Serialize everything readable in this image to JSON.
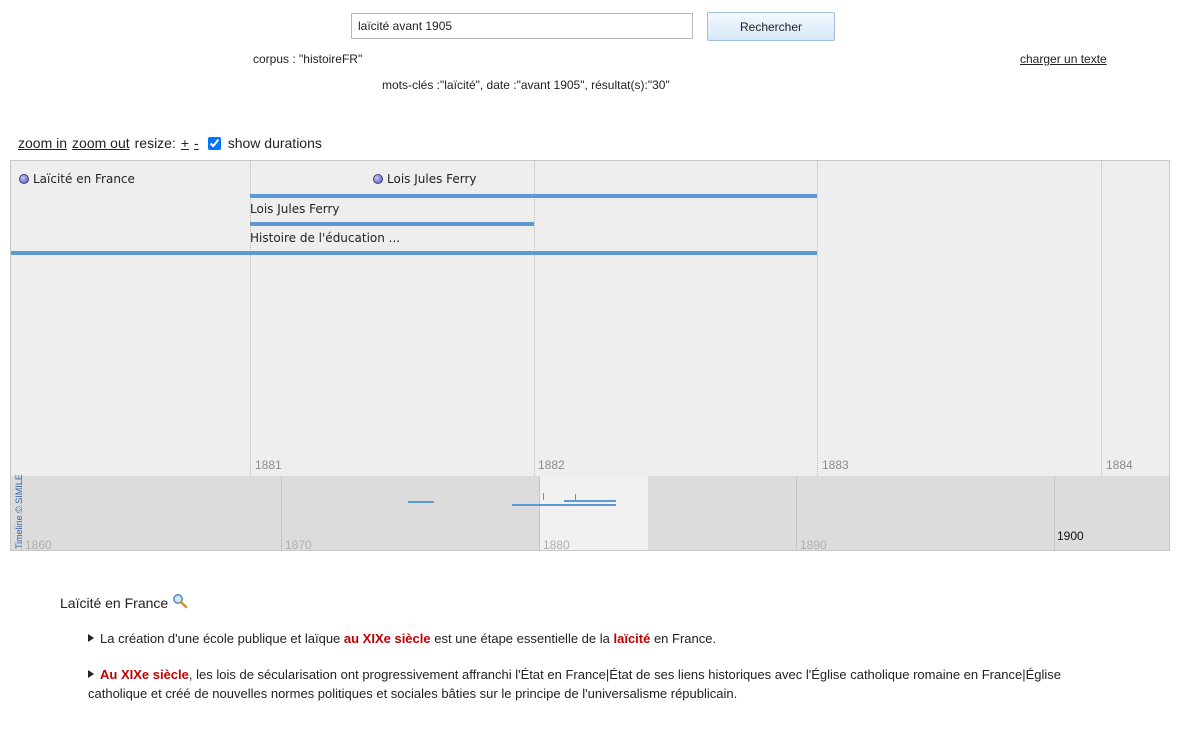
{
  "search": {
    "query": "laïcité avant 1905",
    "button_label": "Rechercher"
  },
  "corpus_text": "corpus : \"histoireFR\"",
  "load_link": "charger un texte",
  "keywords_text": "mots-clés :\"laïcité\", date :\"avant 1905\", résultat(s):\"30\"",
  "toolbar": {
    "zoom_in": "zoom in",
    "zoom_out": "zoom out",
    "resize_label": "resize:",
    "resize_plus": "+",
    "resize_minus": "-",
    "show_durations": "show durations",
    "show_durations_checked": true
  },
  "timeline": {
    "upper_ticks": [
      "1881",
      "1882",
      "1883",
      "1884"
    ],
    "lower_ticks": [
      "1860",
      "1870",
      "1880",
      "1890"
    ],
    "lower_current_year": "1900",
    "copyright": "Timeline © SIMILE",
    "events": [
      {
        "label": "Laïcité en France"
      },
      {
        "label": "Lois Jules Ferry"
      }
    ],
    "bar_labels": [
      "Lois Jules Ferry",
      "Histoire de l'éducation ..."
    ],
    "bar_color": "#5c9ad6",
    "dot_color": "#5656b8"
  },
  "details": {
    "title": "Laïcité en France",
    "title_icon": "magnifier-icon",
    "items": [
      {
        "pre": "La création d'une école publique et laïque ",
        "hl1": "au XIXe siècle",
        "mid": " est une étape essentielle de la ",
        "hl2": "laïcité",
        "post": " en France."
      },
      {
        "hl1": "Au XIXe siècle",
        "post": ", les lois de sécularisation ont progressivement affranchi l'État en France|État de ses liens historiques avec l'Église catholique romaine en France|Église catholique et créé de nouvelles normes politiques et sociales bâties sur le principe de l'universalisme républicain."
      }
    ],
    "highlight_color": "#c00000"
  }
}
